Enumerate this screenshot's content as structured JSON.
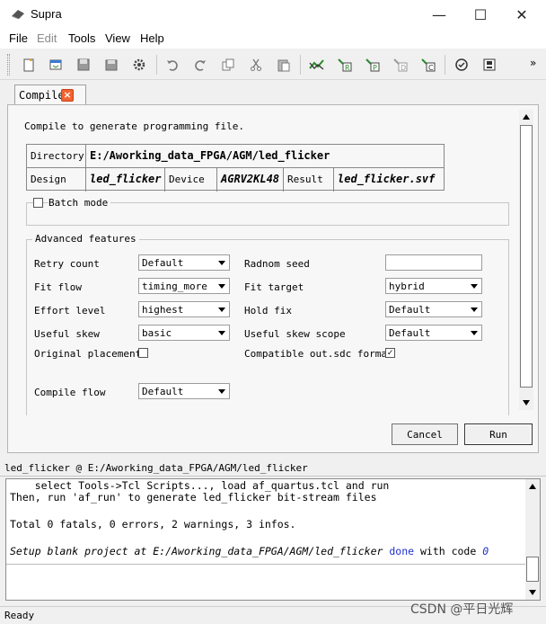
{
  "window": {
    "title": "Supra",
    "minimize": "—",
    "maximize": "☐",
    "close": "✕"
  },
  "menubar": [
    "File",
    "Edit",
    "Tools",
    "View",
    "Help"
  ],
  "toolbar": {
    "icons": [
      "new-file-icon",
      "open-project-icon",
      "save-icon",
      "save-as-icon",
      "settings-icon",
      "undo-icon",
      "redo-icon",
      "copy-icon",
      "cut-icon",
      "paste-icon",
      "compile-flow-icon",
      "run-r-icon",
      "run-p-icon",
      "run-d-icon",
      "run-c-icon",
      "check-icon",
      "report-icon"
    ],
    "overflow": "»"
  },
  "tab": {
    "label": "Compile",
    "close": "×"
  },
  "compile": {
    "intro": "Compile to generate programming file.",
    "directory_label": "Directory",
    "directory_value": "E:/Aworking_data_FPGA/AGM/led_flicker",
    "design_label": "Design",
    "design_value": "led_flicker",
    "device_label": "Device",
    "device_value": "AGRV2KL48",
    "result_label": "Result",
    "result_value": "led_flicker.svf",
    "batch_mode_label": "Batch mode",
    "batch_mode_checked": false,
    "advanced_title": "Advanced features",
    "fields_left": [
      {
        "label": "Retry count",
        "value": "Default"
      },
      {
        "label": "Fit flow",
        "value": "timing_more"
      },
      {
        "label": "Effort level",
        "value": "highest"
      },
      {
        "label": "Useful skew",
        "value": "basic"
      }
    ],
    "fields_right": [
      {
        "label": "Radnom seed",
        "value": ""
      },
      {
        "label": "Fit target",
        "value": "hybrid"
      },
      {
        "label": "Hold fix",
        "value": "Default"
      },
      {
        "label": "Useful skew scope",
        "value": "Default"
      }
    ],
    "original_placement_label": "Original placement",
    "original_placement_checked": false,
    "compatible_sdc_label": "Compatible out.sdc format",
    "compatible_sdc_checked": true,
    "compile_flow_label": "Compile flow",
    "compile_flow_value": "Default",
    "cancel_label": "Cancel",
    "run_label": "Run"
  },
  "console": {
    "title": "led_flicker @ E:/Aworking_data_FPGA/AGM/led_flicker",
    "lines": [
      "    select Tools->Tcl Scripts..., load af_quartus.tcl and run",
      "Then, run 'af_run' to generate led_flicker bit-stream files",
      "",
      "Total 0 fatals, 0 errors, 2 warnings, 3 infos."
    ],
    "setup_prefix": "Setup blank project at E:/Aworking_data_FPGA/AGM/led_flicker ",
    "setup_done": "done",
    "setup_mid": " with code ",
    "setup_code": "0"
  },
  "status": "Ready",
  "watermark": "CSDN @平日光辉"
}
